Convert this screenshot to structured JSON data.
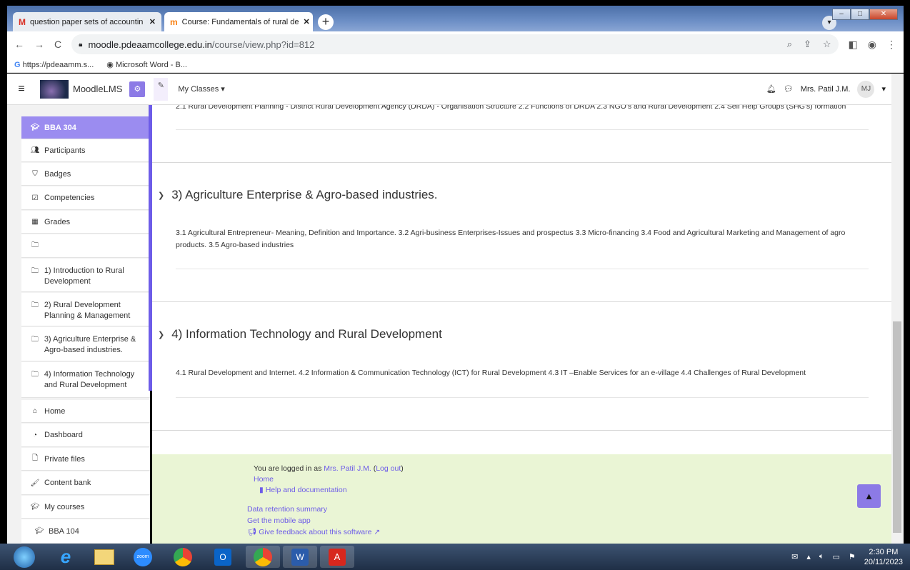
{
  "browser": {
    "tabs": [
      {
        "icon": "gmail-icon",
        "label": "question paper sets of accountin",
        "active": false
      },
      {
        "icon": "moodle-icon",
        "label": "Course: Fundamentals of rural de",
        "active": true
      }
    ],
    "new_tab_label": "+",
    "url_host": "moodle.pdeaamcollege.edu.in",
    "url_path": "/course/view.php?id=812",
    "bookmarks": [
      {
        "icon": "google-icon",
        "label": "https://pdeaamm.s..."
      },
      {
        "icon": "globe-icon",
        "label": "Microsoft Word - B..."
      }
    ]
  },
  "navbar": {
    "brand": "MoodleLMS",
    "my_classes": "My Classes",
    "user_name": "Mrs. Patil J.M.",
    "avatar_initials": "MJ"
  },
  "sidebar": {
    "course": "BBA 304",
    "items": [
      {
        "icon": "users-icon",
        "label": "Participants"
      },
      {
        "icon": "shield-icon",
        "label": "Badges"
      },
      {
        "icon": "checkbox-icon",
        "label": "Competencies"
      },
      {
        "icon": "table-icon",
        "label": "Grades"
      },
      {
        "icon": "folder-icon",
        "label": ""
      },
      {
        "icon": "folder-icon",
        "label": "1) Introduction to Rural Development"
      },
      {
        "icon": "folder-icon",
        "label": "2) Rural Development Planning & Management"
      },
      {
        "icon": "folder-icon",
        "label": "3) Agriculture Enterprise & Agro-based industries."
      },
      {
        "icon": "folder-icon",
        "label": "4) Information Technology and Rural Development"
      },
      {
        "icon": "home-icon",
        "label": "Home"
      },
      {
        "icon": "dashboard-icon",
        "label": "Dashboard"
      },
      {
        "icon": "file-icon",
        "label": "Private files"
      },
      {
        "icon": "brush-icon",
        "label": "Content bank"
      },
      {
        "icon": "graduation-cap-icon",
        "label": "My courses"
      },
      {
        "icon": "graduation-cap-icon",
        "label": "BBA 104"
      }
    ]
  },
  "main": {
    "top_text": "2.1 Rural Development Planning - District Rural Development Agency (DRDA) - Organisation Structure 2.2 Functions of DRDA 2.3 NGO's and Rural Development 2.4 Self Help Groups (SHG's) formation",
    "sections": [
      {
        "title": "3) Agriculture Enterprise & Agro-based industries.",
        "text": "3.1 Agricultural Entrepreneur- Meaning, Definition and Importance. 3.2 Agri-business Enterprises-Issues and prospectus 3.3 Micro-financing 3.4 Food and Agricultural Marketing and Management of agro products. 3.5 Agro-based industries"
      },
      {
        "title": "4) Information Technology and Rural Development",
        "text": "4.1 Rural Development and Internet. 4.2 Information & Communication Technology (ICT) for Rural Development 4.3 IT –Enable Services for an e-village 4.4 Challenges of Rural Development"
      }
    ]
  },
  "footer": {
    "logged_in_prefix": "You are logged in as ",
    "logged_in_user": "Mrs. Patil J.M.",
    "logout_open": " (",
    "logout": "Log out",
    "logout_close": ")",
    "home": "Home",
    "help": "Help and documentation",
    "data_retention": "Data retention summary",
    "mobile_app": "Get the mobile app",
    "feedback": "Give feedback about this software"
  },
  "taskbar": {
    "apps": [
      "start-orb-icon",
      "internet-explorer-icon",
      "file-explorer-icon",
      "zoom-icon",
      "chrome-icon",
      "outlook-icon",
      "chrome-profile-icon",
      "word-icon",
      "acrobat-icon"
    ],
    "zoom_label": "zoom",
    "time": "2:30 PM",
    "date": "20/11/2023"
  }
}
